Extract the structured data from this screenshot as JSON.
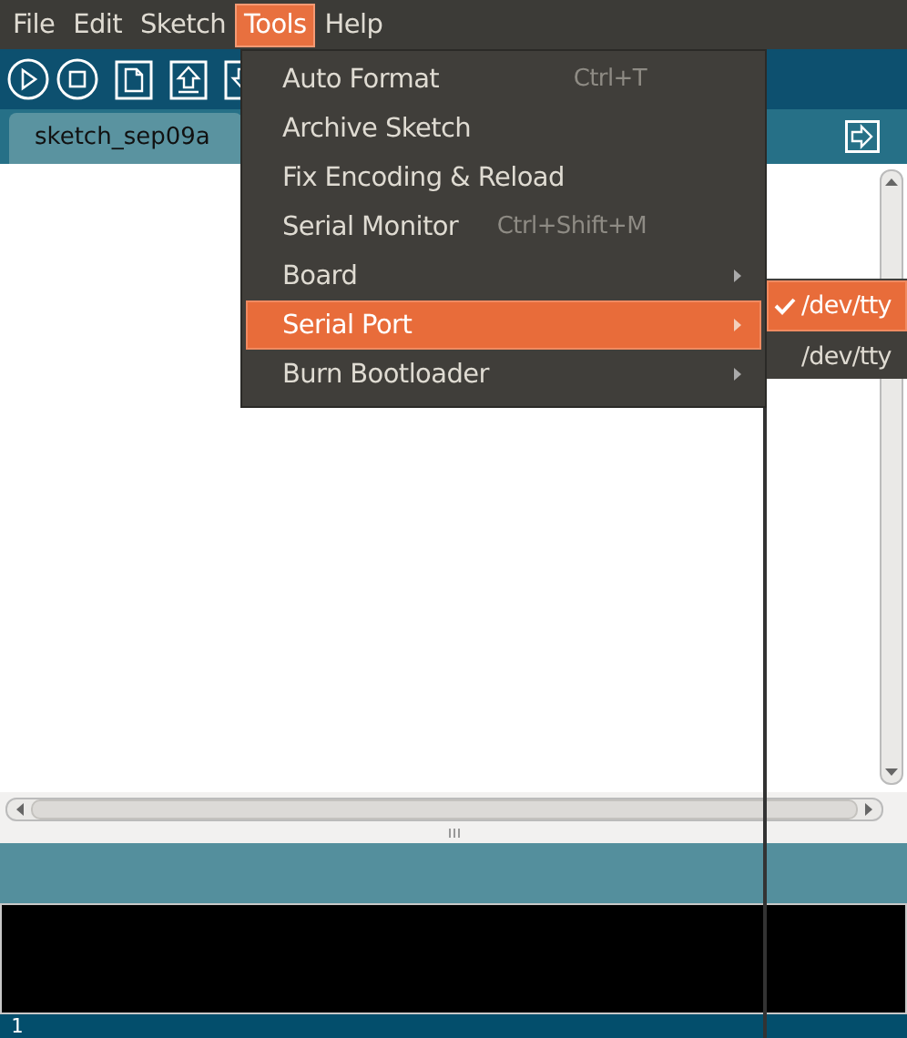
{
  "menu_bar": [
    {
      "label": "File",
      "selected": false
    },
    {
      "label": "Edit",
      "selected": false
    },
    {
      "label": "Sketch",
      "selected": false
    },
    {
      "label": "Tools",
      "selected": true
    },
    {
      "label": "Help",
      "selected": false
    }
  ],
  "toolbar": [
    {
      "kind": "run"
    },
    {
      "kind": "stop"
    },
    {
      "kind": "new"
    },
    {
      "kind": "open"
    },
    {
      "kind": "save"
    }
  ],
  "tabs": [
    {
      "label": "sketch_sep09a",
      "selected": true
    }
  ],
  "tools_menu": [
    {
      "label": "Auto Format",
      "shortcut": "Ctrl+T",
      "submenu": false,
      "selected": false
    },
    {
      "label": "Archive Sketch",
      "submenu": false,
      "selected": false
    },
    {
      "label": "Fix Encoding & Reload",
      "submenu": false,
      "selected": false
    },
    {
      "label": "Serial Monitor",
      "shortcut": "Ctrl+Shift+M",
      "submenu": false,
      "selected": false
    },
    {
      "label": "Board",
      "submenu": true,
      "selected": false
    },
    {
      "label": "Serial Port",
      "submenu": true,
      "selected": true
    },
    {
      "label": "Burn Bootloader",
      "submenu": true,
      "selected": false
    }
  ],
  "serial_port_menu": [
    {
      "label": "/dev/tty",
      "checked": true,
      "selected": true
    },
    {
      "label": "/dev/tty",
      "checked": false,
      "selected": false
    }
  ],
  "status_bar": {
    "line": "1"
  }
}
